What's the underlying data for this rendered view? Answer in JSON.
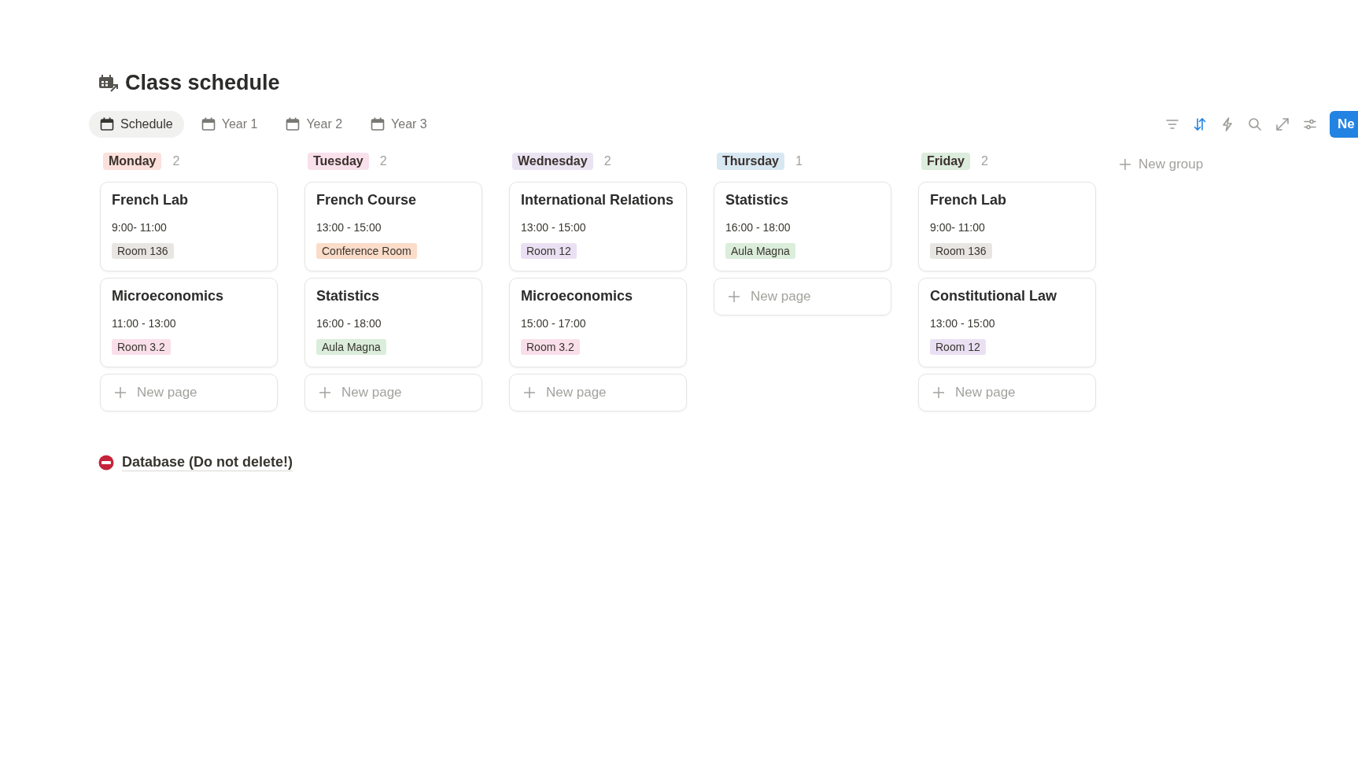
{
  "page": {
    "title": "Class schedule"
  },
  "tabs": [
    {
      "label": "Schedule",
      "selected": true
    },
    {
      "label": "Year 1",
      "selected": false
    },
    {
      "label": "Year 2",
      "selected": false
    },
    {
      "label": "Year 3",
      "selected": false
    }
  ],
  "toolbar": [
    {
      "kind": "filter",
      "active": false
    },
    {
      "kind": "sort",
      "active": true
    },
    {
      "kind": "automation",
      "active": false
    },
    {
      "kind": "search",
      "active": false
    },
    {
      "kind": "expand",
      "active": false
    },
    {
      "kind": "settings",
      "active": false
    }
  ],
  "new_button": {
    "label": "Ne"
  },
  "groups": [
    {
      "name": "Monday",
      "count": "2",
      "color": "#fbe0dc",
      "cards": [
        {
          "title": "French Lab",
          "time": "9:00- 11:00",
          "room": "Room 136",
          "color": "#e8e6e3"
        },
        {
          "title": "Microeconomics",
          "time": "11:00 - 13:00",
          "room": "Room 3.2",
          "color": "#f9dfe9"
        }
      ],
      "new_page": "New page"
    },
    {
      "name": "Tuesday",
      "count": "2",
      "color": "#f9e1ec",
      "cards": [
        {
          "title": "French Course",
          "time": "13:00 - 15:00",
          "room": "Conference Room",
          "color": "#fadcc9"
        },
        {
          "title": "Statistics",
          "time": "16:00 - 18:00",
          "room": "Aula Magna",
          "color": "#dbeddb"
        }
      ],
      "new_page": "New page"
    },
    {
      "name": "Wednesday",
      "count": "2",
      "color": "#eae4f2",
      "cards": [
        {
          "title": "International Relations",
          "time": "13:00 - 15:00",
          "room": "Room 12",
          "color": "#eae0f3"
        },
        {
          "title": "Microeconomics",
          "time": "15:00 - 17:00",
          "room": "Room 3.2",
          "color": "#f9dfe9"
        }
      ],
      "new_page": "New page"
    },
    {
      "name": "Thursday",
      "count": "1",
      "color": "#d8e8f3",
      "cards": [
        {
          "title": "Statistics",
          "time": "16:00 - 18:00",
          "room": "Aula Magna",
          "color": "#dbeddb"
        }
      ],
      "new_page": "New page"
    },
    {
      "name": "Friday",
      "count": "2",
      "color": "#dcecdd",
      "cards": [
        {
          "title": "French Lab",
          "time": "9:00- 11:00",
          "room": "Room 136",
          "color": "#e8e6e3"
        },
        {
          "title": "Constitutional Law",
          "time": "13:00 - 15:00",
          "room": "Room 12",
          "color": "#eae0f3"
        }
      ],
      "new_page": "New page"
    }
  ],
  "new_group": "New group",
  "database_link": "Database (Do not delete!)"
}
